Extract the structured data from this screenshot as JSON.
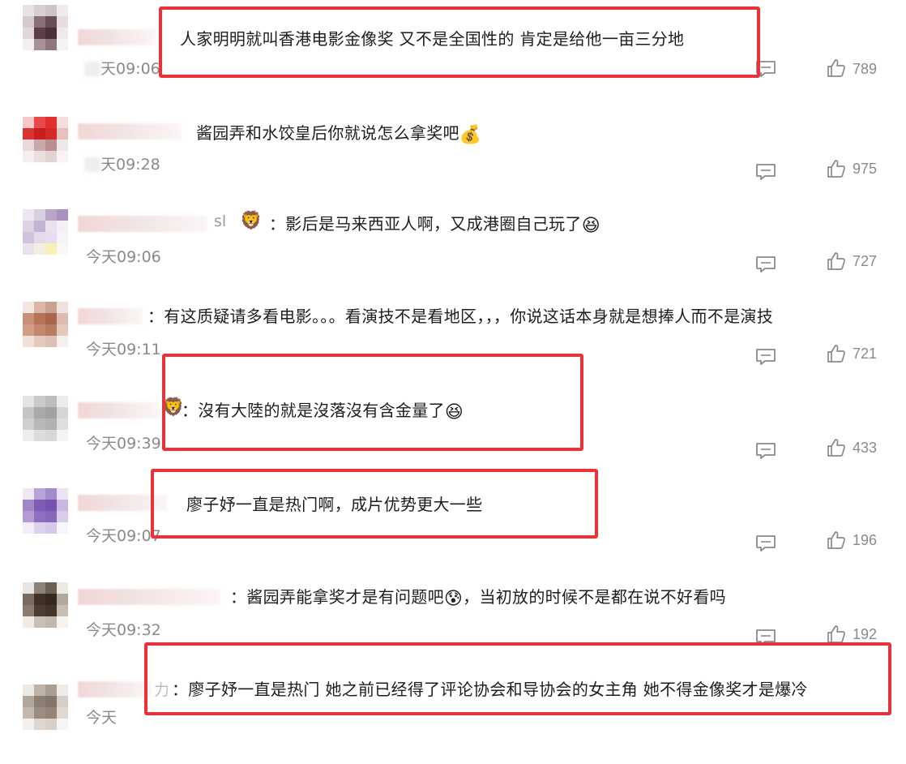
{
  "comments": [
    {
      "prefix": "",
      "text": "人家明明就叫香港电影金像奖 又不是全国性的 肯定是给他一亩三分地",
      "emoji": "",
      "time": "天09:06",
      "likes": "789"
    },
    {
      "prefix": "",
      "text": "酱园弄和水饺皇后你就说怎么拿奖吧",
      "emoji": "💰",
      "time": "天09:28",
      "likes": "975"
    },
    {
      "prefix": "sl",
      "text": "：影后是马来西亚人啊，又成港圈自己玩了",
      "emoji": "😆",
      "time": "今天09:06",
      "likes": "727"
    },
    {
      "prefix": "",
      "text": "：有这质疑请多看电影。。。看演技不是看地区，，，你说这话本身就是想捧人而不是演技",
      "emoji": "",
      "time": "今天09:11",
      "likes": "721"
    },
    {
      "prefix": "",
      "text": "：沒有大陸的就是沒落沒有含金量了",
      "emoji": "😆",
      "time": "今天09:39",
      "likes": "433"
    },
    {
      "prefix": "",
      "text": "廖子妤一直是热门啊，成片优势更大一些",
      "emoji": "",
      "time": "今天09:07",
      "likes": "196"
    },
    {
      "prefix": "",
      "text": "：酱园弄能拿奖才是有问题吧",
      "emoji": "😰",
      "text2": "，当初放的时候不是都在说不好看吗",
      "time": "今天09:32",
      "likes": "192"
    },
    {
      "prefix": "力",
      "text": "：廖子妤一直是热门 她之前已经得了评论协会和导协会的女主角 她不得金像奖才是爆冷",
      "emoji": "",
      "time": "今天",
      "likes": ""
    }
  ],
  "icons": {
    "reply": "comment-icon",
    "like": "thumbs-up-icon"
  },
  "colors": {
    "highlight_box": "#e8333a",
    "meta_text": "#8a8a8a"
  }
}
